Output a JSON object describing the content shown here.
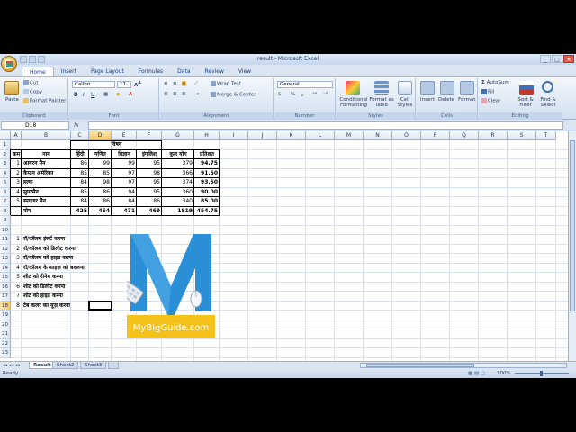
{
  "window": {
    "title": "result - Microsoft Excel"
  },
  "tabs": [
    "Home",
    "Insert",
    "Page Layout",
    "Formulas",
    "Data",
    "Review",
    "View"
  ],
  "ribbon": {
    "clipboard": {
      "paste": "Paste",
      "cut": "Cut",
      "copy": "Copy",
      "format_painter": "Format Painter",
      "label": "Clipboard"
    },
    "font": {
      "name": "Calibri",
      "size": "11",
      "label": "Font"
    },
    "alignment": {
      "wrap": "Wrap Text",
      "merge": "Merge & Center",
      "label": "Alignment"
    },
    "number": {
      "format": "General",
      "label": "Number",
      "percent": "%",
      "comma": ","
    },
    "styles": {
      "cond": "Conditional Formatting",
      "table": "Format as Table",
      "cell": "Cell Styles",
      "label": "Styles"
    },
    "cells": {
      "insert": "Insert",
      "delete": "Delete",
      "format": "Format",
      "label": "Cells"
    },
    "editing": {
      "autosum": "AutoSum",
      "fill": "Fill",
      "clear": "Clear",
      "sort": "Sort & Filter",
      "find": "Find & Select",
      "label": "Editing"
    }
  },
  "name_box": "D18",
  "fx": "fx",
  "columns": [
    "A",
    "B",
    "C",
    "D",
    "E",
    "F",
    "G",
    "H",
    "I",
    "J",
    "K",
    "L",
    "M",
    "N",
    "O",
    "P",
    "Q",
    "R",
    "S",
    "T"
  ],
  "rows": [
    "1",
    "2",
    "3",
    "4",
    "5",
    "6",
    "7",
    "8",
    "9",
    "10",
    "11",
    "12",
    "13",
    "14",
    "15",
    "16",
    "17",
    "18",
    "19",
    "20",
    "21",
    "22",
    "23"
  ],
  "table": {
    "header_group": "विषय",
    "headers": [
      "क्रम",
      "नाम",
      "हिंदी",
      "गणित",
      "विज्ञान",
      "इंगलिश",
      "कुल योग",
      "प्रतिशत"
    ],
    "rows": [
      [
        "1",
        "आयरन मैन",
        "86",
        "99",
        "99",
        "95",
        "379",
        "94.75"
      ],
      [
        "2",
        "कैप्टन अमेरिका",
        "85",
        "85",
        "97",
        "98",
        "366",
        "91.50"
      ],
      [
        "3",
        "हल्क",
        "84",
        "98",
        "97",
        "95",
        "374",
        "93.50"
      ],
      [
        "4",
        "सुपरमैन",
        "85",
        "86",
        "94",
        "95",
        "360",
        "90.00"
      ],
      [
        "5",
        "स्पाइडर मैन",
        "84",
        "86",
        "84",
        "86",
        "340",
        "85.00"
      ]
    ],
    "total": [
      "",
      "योग",
      "425",
      "454",
      "471",
      "469",
      "1819",
      "454.75"
    ]
  },
  "notes": [
    {
      "n": "1",
      "text": "रॉ/कॉलम इंसर्ट करना"
    },
    {
      "n": "2",
      "text": "रॉ/कॉलम को डिलीट करना"
    },
    {
      "n": "3",
      "text": "रॉ/कॉलम को हाइड करना"
    },
    {
      "n": "4",
      "text": "रॉ/कॉलम के साइज़ को बदलना"
    },
    {
      "n": "5",
      "text": "शीट को रीनेम करना"
    },
    {
      "n": "6",
      "text": "शीट को डिलीट करना"
    },
    {
      "n": "7",
      "text": "शीट को हाइड करना"
    },
    {
      "n": "8",
      "text": "टेब कलर का यूज़ करना"
    }
  ],
  "logo": {
    "text": "MyBigGuide.com",
    "blue": "#2a8fd6",
    "yellow": "#f5c21b"
  },
  "sheets": [
    "Result",
    "Sheet2",
    "Sheet3"
  ],
  "status": {
    "ready": "Ready",
    "zoom": "100%"
  },
  "colors": {
    "ribbon": "#dbe5f2",
    "accent": "#15428b",
    "selected": "#f7c96c"
  }
}
